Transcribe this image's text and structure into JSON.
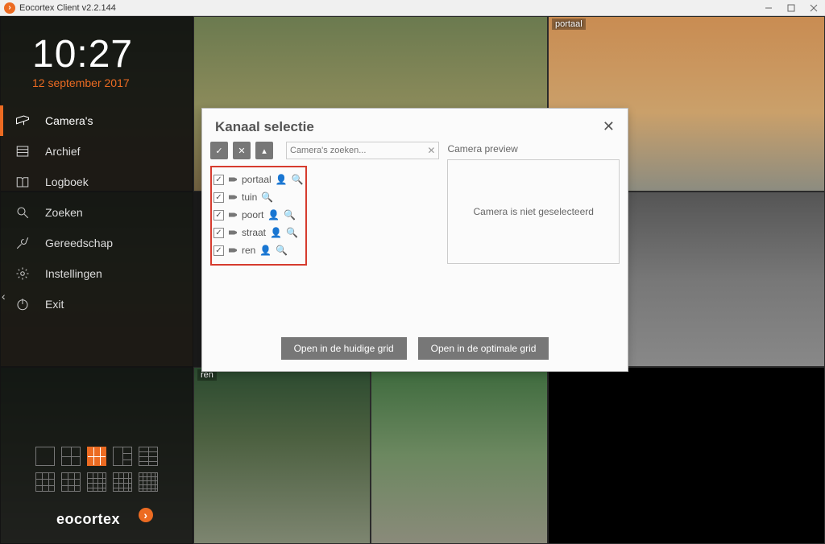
{
  "window": {
    "title": "Eocortex Client v2.2.144"
  },
  "clock": {
    "time": "10:27",
    "date": "12 september 2017"
  },
  "nav": {
    "items": [
      {
        "label": "Camera's"
      },
      {
        "label": "Archief"
      },
      {
        "label": "Logboek"
      },
      {
        "label": "Zoeken"
      },
      {
        "label": "Gereedschap"
      },
      {
        "label": "Instellingen"
      },
      {
        "label": "Exit"
      }
    ]
  },
  "brand": "eocortex",
  "dialog": {
    "title": "Kanaal selectie",
    "search_placeholder": "Camera's zoeken...",
    "preview_label": "Camera preview",
    "preview_empty": "Camera is niet geselecteerd",
    "btn_current": "Open in de huidige grid",
    "btn_optimal": "Open in de optimale grid",
    "cameras": [
      {
        "name": "portaal"
      },
      {
        "name": "tuin"
      },
      {
        "name": "poort"
      },
      {
        "name": "straat"
      },
      {
        "name": "ren"
      }
    ]
  },
  "tiles": {
    "portaal": "portaal",
    "ren": "ren"
  }
}
